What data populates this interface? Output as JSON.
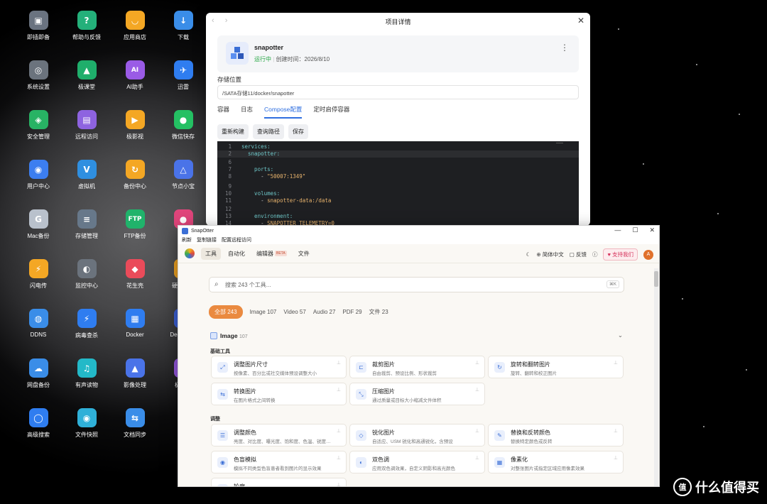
{
  "desktop": {
    "icons": [
      {
        "label": "即插即备",
        "glyph": "▣",
        "color": "#6a7380"
      },
      {
        "label": "帮助与反馈",
        "glyph": "?",
        "color": "#24b07a"
      },
      {
        "label": "应用商店",
        "glyph": "◡",
        "color": "#f4a724"
      },
      {
        "label": "下载",
        "glyph": "↓",
        "color": "#3a8de8"
      },
      {
        "label": "系统设置",
        "glyph": "◎",
        "color": "#6b737d"
      },
      {
        "label": "极课堂",
        "glyph": "▲",
        "color": "#1fae6b"
      },
      {
        "label": "AI助手",
        "glyph": "AI",
        "color": "#9a5be6"
      },
      {
        "label": "迅雷",
        "glyph": "✈",
        "color": "#2f7df0"
      },
      {
        "label": "安全管理",
        "glyph": "◈",
        "color": "#28b364"
      },
      {
        "label": "远程访问",
        "glyph": "▤",
        "color": "#8e63e0"
      },
      {
        "label": "极影视",
        "glyph": "▶",
        "color": "#f4a724"
      },
      {
        "label": "微信快存",
        "glyph": "●",
        "color": "#24c063"
      },
      {
        "label": "用户中心",
        "glyph": "◉",
        "color": "#3c7ef0"
      },
      {
        "label": "虚拟机",
        "glyph": "V",
        "color": "#2f8fe0"
      },
      {
        "label": "备份中心",
        "glyph": "↻",
        "color": "#f4a724"
      },
      {
        "label": "节点小宝",
        "glyph": "△",
        "color": "#4a73e8"
      },
      {
        "label": "Mac备份",
        "glyph": "G",
        "color": "#b9c1cc"
      },
      {
        "label": "存储管理",
        "glyph": "≡",
        "color": "#67788a"
      },
      {
        "label": "FTP备份",
        "glyph": "FTP",
        "color": "#20b36b"
      },
      {
        "label": "",
        "glyph": "●",
        "color": "#e0457b"
      },
      {
        "label": "闪电传",
        "glyph": "⚡",
        "color": "#f4a724"
      },
      {
        "label": "监控中心",
        "glyph": "◐",
        "color": "#6b737d"
      },
      {
        "label": "花生壳",
        "glyph": "◆",
        "color": "#ea4b5a"
      },
      {
        "label": "硬盘搬家",
        "glyph": "▤",
        "color": "#f4a724"
      },
      {
        "label": "DDNS",
        "glyph": "◍",
        "color": "#3a8de8"
      },
      {
        "label": "病毒查杀",
        "glyph": "⚡",
        "color": "#2f7df0"
      },
      {
        "label": "Docker",
        "glyph": "▦",
        "color": "#2f7df0"
      },
      {
        "label": "DeepSeek",
        "glyph": "◠",
        "color": "#3d63dc"
      },
      {
        "label": "网盘备份",
        "glyph": "☁",
        "color": "#3a8de8"
      },
      {
        "label": "有声读物",
        "glyph": "♫",
        "color": "#23b9c8"
      },
      {
        "label": "影像处理",
        "glyph": "▲",
        "color": "#4a73e8"
      },
      {
        "label": "极音乐",
        "glyph": "♪",
        "color": "#9a5be6"
      },
      {
        "label": "高级搜索",
        "glyph": "◯",
        "color": "#2f7df0"
      },
      {
        "label": "文件快照",
        "glyph": "◉",
        "color": "#2fb0d8"
      },
      {
        "label": "文档同步",
        "glyph": "⇆",
        "color": "#3a8de8"
      }
    ]
  },
  "project_window": {
    "title": "项目详情",
    "close": "✕",
    "nav_arrows": "‹ ›",
    "app_name": "snapotter",
    "status": "运行中",
    "created": "创建时间：2026/8/10",
    "more": "⋮",
    "storage_label": "存储位置",
    "storage_path": "/SATA存储11/docker/snapotter",
    "tabs": [
      "容器",
      "日志",
      "Compose配置",
      "定时启停容器"
    ],
    "active_tab": "Compose配置",
    "buttons": [
      "重新构建",
      "查询路径",
      "保存"
    ],
    "code_lines": [
      {
        "n": "1",
        "t": "services:"
      },
      {
        "n": "2",
        "t": "  snapotter:"
      },
      {
        "n": "6",
        "t": ""
      },
      {
        "n": "7",
        "t": "    ports:"
      },
      {
        "n": "8",
        "t": "      - \"50007:1349\""
      },
      {
        "n": "9",
        "t": ""
      },
      {
        "n": "10",
        "t": "    volumes:"
      },
      {
        "n": "11",
        "t": "      - snapotter-data:/data"
      },
      {
        "n": "12",
        "t": ""
      },
      {
        "n": "13",
        "t": "    environment:"
      },
      {
        "n": "14",
        "t": "      - SNAPOTTER_TELEMETRY=0"
      }
    ]
  },
  "snap_window": {
    "title": "SnapOtter",
    "win_controls": [
      "—",
      "☐",
      "✕"
    ],
    "menu": [
      "刷新",
      "复制链接",
      "配置远程访问"
    ],
    "tabs": [
      "工具",
      "自动化",
      "编辑器",
      "文件"
    ],
    "active_tab": "工具",
    "beta": "BETA",
    "lang": "简体中文",
    "feedback": "反馈",
    "support": "支持我们",
    "avatar": "A",
    "search_placeholder": "搜索 243 个工具...",
    "search_kbd": "⌘K",
    "chips": [
      "全部 243",
      "Image 107",
      "Video 57",
      "Audio 27",
      "PDF 29",
      "文件 23"
    ],
    "section_title": "Image",
    "section_count": "107",
    "group_basic": "基础工具",
    "group_adjust": "调整",
    "tools_basic": [
      {
        "name": "调整图片尺寸",
        "desc": "按像素、百分比或社交媒体预设调整大小",
        "icon": "⤢"
      },
      {
        "name": "裁剪图片",
        "desc": "自由裁剪、预设比例、形状裁剪",
        "icon": "⊏"
      },
      {
        "name": "旋转和翻转图片",
        "desc": "旋转、翻转和校正图片",
        "icon": "↻"
      },
      {
        "name": "转换图片",
        "desc": "在图片格式之间转换",
        "icon": "⇆"
      },
      {
        "name": "压缩图片",
        "desc": "通过质量或目标大小缩减文件体积",
        "icon": "⤡"
      }
    ],
    "tools_adjust": [
      {
        "name": "调整颜色",
        "desc": "亮度、对比度、曝光度、饱和度、色温、锐度…",
        "icon": "☰"
      },
      {
        "name": "锐化图片",
        "desc": "自适应、USM 锐化和高通锐化，含预设",
        "icon": "◇"
      },
      {
        "name": "替换和反转颜色",
        "desc": "替换特定颜色或反转",
        "icon": "✎"
      },
      {
        "name": "色盲模拟",
        "desc": "模拟不同类型色盲患者看到图片的显示效果",
        "icon": "◉"
      },
      {
        "name": "双色调",
        "desc": "应用双色调效果，自定义阴影和高光颜色",
        "icon": "◐"
      },
      {
        "name": "像素化",
        "desc": "对整张图片或指定区域应用像素效果",
        "icon": "▦"
      },
      {
        "name": "轮廓",
        "desc": "",
        "icon": "○"
      }
    ]
  },
  "watermark": {
    "logo": "值",
    "text": "什么值得买"
  }
}
